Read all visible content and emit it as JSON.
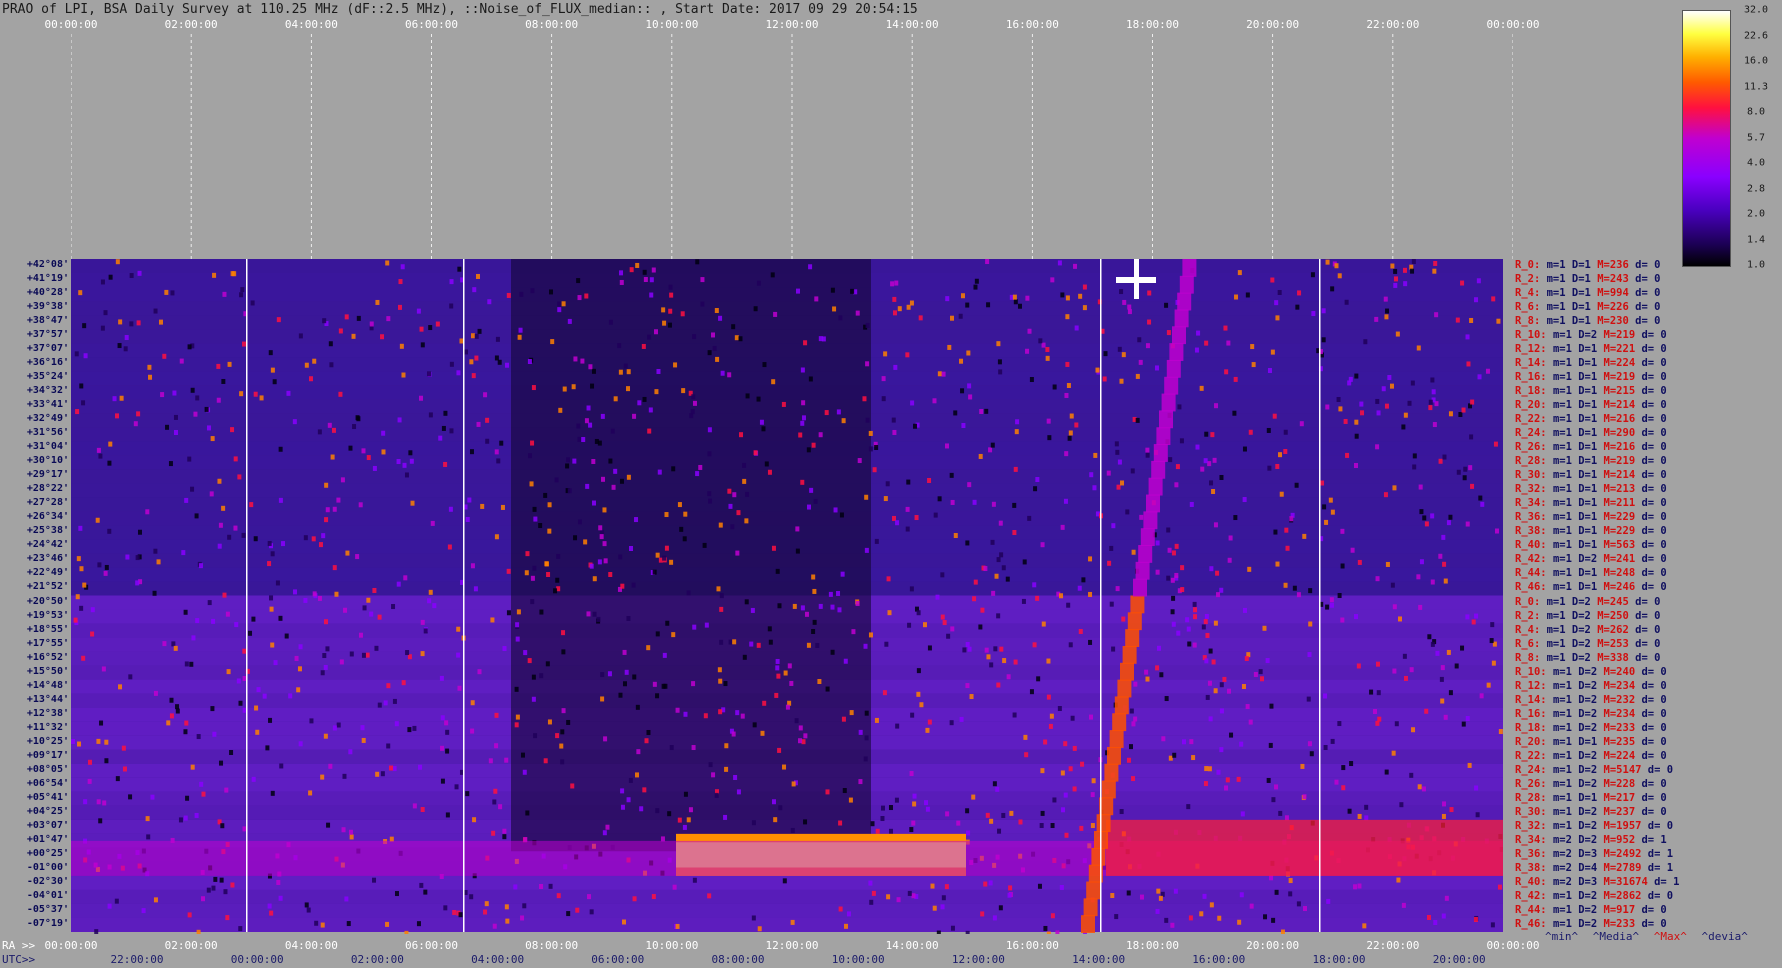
{
  "title": "PRAO of LPI, BSA Daily Survey at 110.25 MHz (dF::2.5 MHz), ::Noise_of_FLUX_median:: , Start Date: 2017 09 29 20:54:15",
  "chart_data": {
    "type": "heatmap",
    "title": "PRAO of LPI, BSA Daily Survey at 110.25 MHz (dF::2.5 MHz), ::Noise_of_FLUX_median:: , Start Date: 2017 09 29 20:54:15",
    "x_top_ticks": [
      "00:00:00",
      "02:00:00",
      "04:00:00",
      "06:00:00",
      "08:00:00",
      "10:00:00",
      "12:00:00",
      "14:00:00",
      "16:00:00",
      "18:00:00",
      "20:00:00",
      "22:00:00",
      "00:00:00"
    ],
    "ra_label": "RA >>",
    "ra_ticks": [
      "00:00:00",
      "02:00:00",
      "04:00:00",
      "06:00:00",
      "08:00:00",
      "10:00:00",
      "12:00:00",
      "14:00:00",
      "16:00:00",
      "18:00:00",
      "20:00:00",
      "22:00:00",
      "00:00:00"
    ],
    "utc_label": "UTC>>",
    "utc_ticks": [
      "22:00:00",
      "00:00:00",
      "02:00:00",
      "04:00:00",
      "06:00:00",
      "08:00:00",
      "10:00:00",
      "12:00:00",
      "14:00:00",
      "16:00:00",
      "18:00:00",
      "20:00:00"
    ],
    "dec_labels": [
      "+42°08'",
      "+41°19'",
      "+40°28'",
      "+39°38'",
      "+38°47'",
      "+37°57'",
      "+37°07'",
      "+36°16'",
      "+35°24'",
      "+34°32'",
      "+33°41'",
      "+32°49'",
      "+31°56'",
      "+31°04'",
      "+30°10'",
      "+29°17'",
      "+28°22'",
      "+27°28'",
      "+26°34'",
      "+25°38'",
      "+24°42'",
      "+23°46'",
      "+22°49'",
      "+21°52'",
      "+20°50'",
      "+19°53'",
      "+18°55'",
      "+17°55'",
      "+16°52'",
      "+15°50'",
      "+14°48'",
      "+13°44'",
      "+12°38'",
      "+11°32'",
      "+10°25'",
      "+09°17'",
      "+08°05'",
      "+06°54'",
      "+05°41'",
      "+04°25'",
      "+03°07'",
      "+01°47'",
      "+00°25'",
      "-01°00'",
      "-02°30'",
      "-04°01'",
      "-05°37'",
      "-07°19'"
    ],
    "beam_stats": [
      {
        "r": "R_0:",
        "m": "m=1",
        "D": "D=1",
        "M": "M=236",
        "d": "d= 0"
      },
      {
        "r": "R_2:",
        "m": "m=1",
        "D": "D=1",
        "M": "M=243",
        "d": "d= 0"
      },
      {
        "r": "R_4:",
        "m": "m=1",
        "D": "D=1",
        "M": "M=994",
        "d": "d= 0"
      },
      {
        "r": "R_6:",
        "m": "m=1",
        "D": "D=1",
        "M": "M=226",
        "d": "d= 0"
      },
      {
        "r": "R_8:",
        "m": "m=1",
        "D": "D=1",
        "M": "M=230",
        "d": "d= 0"
      },
      {
        "r": "R_10:",
        "m": "m=1",
        "D": "D=2",
        "M": "M=219",
        "d": "d= 0"
      },
      {
        "r": "R_12:",
        "m": "m=1",
        "D": "D=1",
        "M": "M=221",
        "d": "d= 0"
      },
      {
        "r": "R_14:",
        "m": "m=1",
        "D": "D=1",
        "M": "M=224",
        "d": "d= 0"
      },
      {
        "r": "R_16:",
        "m": "m=1",
        "D": "D=1",
        "M": "M=219",
        "d": "d= 0"
      },
      {
        "r": "R_18:",
        "m": "m=1",
        "D": "D=1",
        "M": "M=215",
        "d": "d= 0"
      },
      {
        "r": "R_20:",
        "m": "m=1",
        "D": "D=1",
        "M": "M=214",
        "d": "d= 0"
      },
      {
        "r": "R_22:",
        "m": "m=1",
        "D": "D=1",
        "M": "M=216",
        "d": "d= 0"
      },
      {
        "r": "R_24:",
        "m": "m=1",
        "D": "D=1",
        "M": "M=290",
        "d": "d= 0"
      },
      {
        "r": "R_26:",
        "m": "m=1",
        "D": "D=1",
        "M": "M=216",
        "d": "d= 0"
      },
      {
        "r": "R_28:",
        "m": "m=1",
        "D": "D=1",
        "M": "M=219",
        "d": "d= 0"
      },
      {
        "r": "R_30:",
        "m": "m=1",
        "D": "D=1",
        "M": "M=214",
        "d": "d= 0"
      },
      {
        "r": "R_32:",
        "m": "m=1",
        "D": "D=1",
        "M": "M=213",
        "d": "d= 0"
      },
      {
        "r": "R_34:",
        "m": "m=1",
        "D": "D=1",
        "M": "M=211",
        "d": "d= 0"
      },
      {
        "r": "R_36:",
        "m": "m=1",
        "D": "D=1",
        "M": "M=229",
        "d": "d= 0"
      },
      {
        "r": "R_38:",
        "m": "m=1",
        "D": "D=1",
        "M": "M=229",
        "d": "d= 0"
      },
      {
        "r": "R_40:",
        "m": "m=1",
        "D": "D=1",
        "M": "M=563",
        "d": "d= 0"
      },
      {
        "r": "R_42:",
        "m": "m=1",
        "D": "D=2",
        "M": "M=241",
        "d": "d= 0"
      },
      {
        "r": "R_44:",
        "m": "m=1",
        "D": "D=1",
        "M": "M=248",
        "d": "d= 0"
      },
      {
        "r": "R_46:",
        "m": "m=1",
        "D": "D=1",
        "M": "M=246",
        "d": "d= 0"
      },
      {
        "r": "R_0:",
        "m": "m=1",
        "D": "D=2",
        "M": "M=245",
        "d": "d= 0"
      },
      {
        "r": "R_2:",
        "m": "m=1",
        "D": "D=2",
        "M": "M=250",
        "d": "d= 0"
      },
      {
        "r": "R_4:",
        "m": "m=1",
        "D": "D=2",
        "M": "M=262",
        "d": "d= 0"
      },
      {
        "r": "R_6:",
        "m": "m=1",
        "D": "D=2",
        "M": "M=253",
        "d": "d= 0"
      },
      {
        "r": "R_8:",
        "m": "m=1",
        "D": "D=2",
        "M": "M=338",
        "d": "d= 0"
      },
      {
        "r": "R_10:",
        "m": "m=1",
        "D": "D=2",
        "M": "M=240",
        "d": "d= 0"
      },
      {
        "r": "R_12:",
        "m": "m=1",
        "D": "D=2",
        "M": "M=234",
        "d": "d= 0"
      },
      {
        "r": "R_14:",
        "m": "m=1",
        "D": "D=2",
        "M": "M=232",
        "d": "d= 0"
      },
      {
        "r": "R_16:",
        "m": "m=1",
        "D": "D=2",
        "M": "M=234",
        "d": "d= 0"
      },
      {
        "r": "R_18:",
        "m": "m=1",
        "D": "D=2",
        "M": "M=233",
        "d": "d= 0"
      },
      {
        "r": "R_20:",
        "m": "m=1",
        "D": "D=1",
        "M": "M=235",
        "d": "d= 0"
      },
      {
        "r": "R_22:",
        "m": "m=1",
        "D": "D=2",
        "M": "M=224",
        "d": "d= 0"
      },
      {
        "r": "R_24:",
        "m": "m=1",
        "D": "D=2",
        "M": "M=5147",
        "d": "d= 0"
      },
      {
        "r": "R_26:",
        "m": "m=1",
        "D": "D=2",
        "M": "M=228",
        "d": "d= 0"
      },
      {
        "r": "R_28:",
        "m": "m=1",
        "D": "D=1",
        "M": "M=217",
        "d": "d= 0"
      },
      {
        "r": "R_30:",
        "m": "m=1",
        "D": "D=2",
        "M": "M=237",
        "d": "d= 0"
      },
      {
        "r": "R_32:",
        "m": "m=1",
        "D": "D=2",
        "M": "M=1957",
        "d": "d= 0"
      },
      {
        "r": "R_34:",
        "m": "m=2",
        "D": "D=2",
        "M": "M=952",
        "d": "d= 1"
      },
      {
        "r": "R_36:",
        "m": "m=2",
        "D": "D=3",
        "M": "M=2492",
        "d": "d= 1"
      },
      {
        "r": "R_38:",
        "m": "m=2",
        "D": "D=4",
        "M": "M=2789",
        "d": "d= 1"
      },
      {
        "r": "R_40:",
        "m": "m=2",
        "D": "D=3",
        "M": "M=31674",
        "d": "d= 1"
      },
      {
        "r": "R_42:",
        "m": "m=1",
        "D": "D=2",
        "M": "M=2862",
        "d": "d= 0"
      },
      {
        "r": "R_44:",
        "m": "m=1",
        "D": "D=2",
        "M": "M=917",
        "d": "d= 0"
      },
      {
        "r": "R_46:",
        "m": "m=1",
        "D": "D=2",
        "M": "M=233",
        "d": "d= 0"
      }
    ],
    "stat_legend": [
      "^min^",
      "^Media^",
      "^Max^",
      "^devia^"
    ],
    "colorbar_ticks": [
      "32.0",
      "22.6",
      "16.0",
      "11.3",
      "8.0",
      "5.7",
      "4.0",
      "2.8",
      "2.0",
      "1.4",
      "1.0"
    ],
    "colorbar_colors": [
      "#000000",
      "#1a0050",
      "#4a00c0",
      "#8a00ff",
      "#c000d0",
      "#ff1040",
      "#ff5a00",
      "#ffb000",
      "#ffff40",
      "#ffffff"
    ],
    "colors": {
      "background": "#a3a3a3",
      "red_text": "#d01010",
      "blue_text": "#101060"
    }
  }
}
